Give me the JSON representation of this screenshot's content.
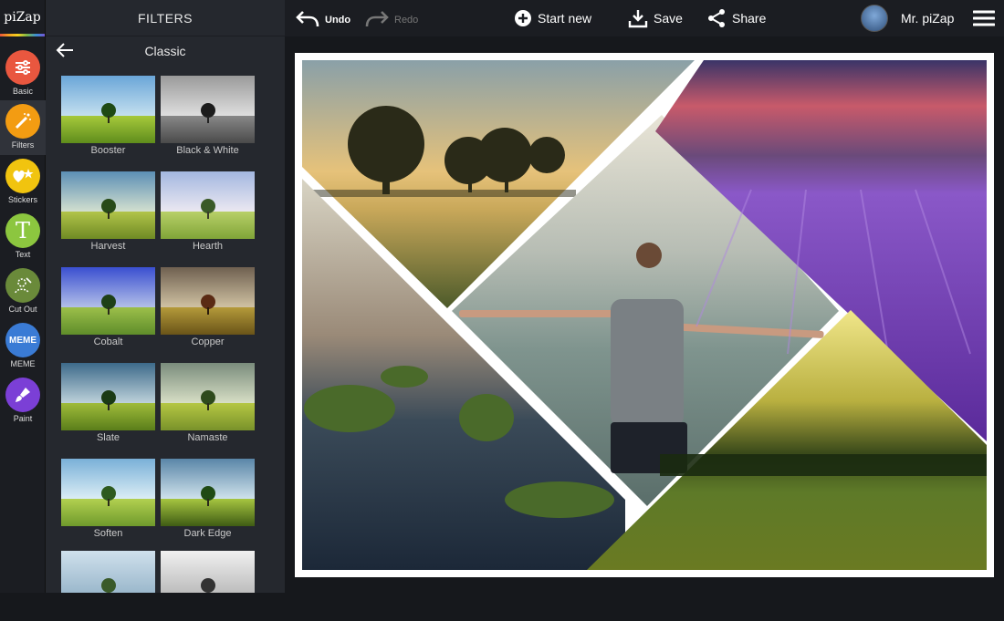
{
  "brand": {
    "logo": "piZap"
  },
  "rail": {
    "tools": [
      {
        "label": "Basic",
        "icon": "sliders-icon",
        "color": "#e9573f"
      },
      {
        "label": "Filters",
        "icon": "magic-wand-icon",
        "color": "#f39c12"
      },
      {
        "label": "Stickers",
        "icon": "heart-star-icon",
        "color": "#f1c40f"
      },
      {
        "label": "Text",
        "icon": "text-t-icon",
        "color": "#8cc63f"
      },
      {
        "label": "Cut Out",
        "icon": "cutout-person-icon",
        "color": "#6a8a3a"
      },
      {
        "label": "MEME",
        "icon": "meme-icon",
        "color": "#3a7bd5"
      },
      {
        "label": "Paint",
        "icon": "paint-brush-icon",
        "color": "#7b3fd6"
      }
    ]
  },
  "panel": {
    "title": "FILTERS",
    "subtitle": "Classic",
    "filters": [
      {
        "label": "Booster"
      },
      {
        "label": "Black & White"
      },
      {
        "label": "Harvest"
      },
      {
        "label": "Hearth"
      },
      {
        "label": "Cobalt"
      },
      {
        "label": "Copper"
      },
      {
        "label": "Slate"
      },
      {
        "label": "Namaste"
      },
      {
        "label": "Soften"
      },
      {
        "label": "Dark Edge"
      },
      {
        "label": ""
      },
      {
        "label": ""
      }
    ]
  },
  "toolbar": {
    "undo": "Undo",
    "redo": "Redo",
    "start_new": "Start new",
    "save": "Save",
    "share": "Share",
    "user": "Mr. piZap"
  }
}
